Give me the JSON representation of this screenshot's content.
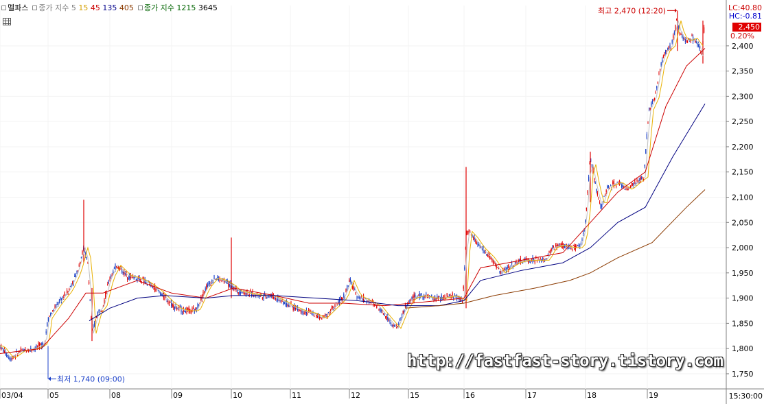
{
  "legend": {
    "title": "멜파스",
    "ma_label": "종가 지수",
    "ma_periods": [
      "5",
      "15",
      "45",
      "135",
      "405"
    ],
    "vol_label": "종가 지수",
    "vol_periods": [
      "1215",
      "3645"
    ]
  },
  "right_panel": {
    "lc": "LC:40.80",
    "hc": "HC:-0.81",
    "current_price": "2,450",
    "change_pct": "0.20%"
  },
  "annotations": {
    "high": "최고 2,470 (12:20)",
    "low": "최저 1,740 (09:00)"
  },
  "watermark": "http://fastfast-story.tistory.com",
  "end_time": "15:30:00",
  "colors": {
    "up": "#e00000",
    "down": "#1a3fc8",
    "ma5": "#c0c0c0",
    "ma15": "#e8b000",
    "ma45": "#cc0000",
    "ma135": "#000080",
    "ma405": "#8b3a00",
    "grid": "#f3f3f3",
    "axis": "#808080"
  },
  "chart_data": {
    "type": "candlestick",
    "title": "멜파스",
    "y_ticks": [
      1750,
      1800,
      1850,
      1900,
      1950,
      2000,
      2050,
      2100,
      2150,
      2200,
      2250,
      2300,
      2350,
      2400
    ],
    "y_tick_labels": [
      "1,750",
      "1,800",
      "1,850",
      "1,900",
      "1,950",
      "2,000",
      "2,050",
      "2,100",
      "2,150",
      "2,200",
      "2,250",
      "2,300",
      "2,350",
      "2,400"
    ],
    "ylim": [
      1720,
      2480
    ],
    "x_labels": [
      "03/04",
      "05",
      "08",
      "09",
      "10",
      "11",
      "12",
      "15",
      "16",
      "17",
      "18",
      "19"
    ],
    "x_label_positions": [
      0,
      70,
      160,
      250,
      337,
      423,
      509,
      595,
      676,
      766,
      853,
      943
    ],
    "x_total": 1058,
    "price_path": [
      [
        0,
        1805
      ],
      [
        15,
        1780
      ],
      [
        30,
        1795
      ],
      [
        50,
        1800
      ],
      [
        65,
        1810
      ],
      [
        70,
        1860
      ],
      [
        85,
        1890
      ],
      [
        100,
        1915
      ],
      [
        112,
        1950
      ],
      [
        122,
        2000
      ],
      [
        128,
        1970
      ],
      [
        134,
        1830
      ],
      [
        142,
        1870
      ],
      [
        150,
        1885
      ],
      [
        160,
        1940
      ],
      [
        170,
        1965
      ],
      [
        185,
        1945
      ],
      [
        200,
        1940
      ],
      [
        215,
        1930
      ],
      [
        230,
        1915
      ],
      [
        245,
        1895
      ],
      [
        258,
        1880
      ],
      [
        270,
        1875
      ],
      [
        285,
        1875
      ],
      [
        300,
        1920
      ],
      [
        312,
        1940
      ],
      [
        325,
        1935
      ],
      [
        337,
        1925
      ],
      [
        345,
        1915
      ],
      [
        360,
        1910
      ],
      [
        380,
        1905
      ],
      [
        395,
        1905
      ],
      [
        410,
        1895
      ],
      [
        423,
        1885
      ],
      [
        440,
        1875
      ],
      [
        455,
        1870
      ],
      [
        470,
        1860
      ],
      [
        485,
        1880
      ],
      [
        500,
        1900
      ],
      [
        510,
        1935
      ],
      [
        520,
        1905
      ],
      [
        535,
        1895
      ],
      [
        550,
        1885
      ],
      [
        565,
        1860
      ],
      [
        578,
        1840
      ],
      [
        590,
        1880
      ],
      [
        600,
        1900
      ],
      [
        615,
        1905
      ],
      [
        630,
        1900
      ],
      [
        645,
        1900
      ],
      [
        660,
        1905
      ],
      [
        674,
        1895
      ],
      [
        680,
        2035
      ],
      [
        690,
        2020
      ],
      [
        700,
        2000
      ],
      [
        715,
        1980
      ],
      [
        730,
        1950
      ],
      [
        740,
        1960
      ],
      [
        752,
        1970
      ],
      [
        765,
        1975
      ],
      [
        780,
        1975
      ],
      [
        795,
        1975
      ],
      [
        805,
        2000
      ],
      [
        818,
        2005
      ],
      [
        832,
        2000
      ],
      [
        845,
        2000
      ],
      [
        852,
        2040
      ],
      [
        860,
        2180
      ],
      [
        868,
        2120
      ],
      [
        876,
        2080
      ],
      [
        885,
        2120
      ],
      [
        900,
        2130
      ],
      [
        915,
        2115
      ],
      [
        928,
        2130
      ],
      [
        938,
        2140
      ],
      [
        945,
        2270
      ],
      [
        955,
        2300
      ],
      [
        962,
        2360
      ],
      [
        970,
        2390
      ],
      [
        978,
        2400
      ],
      [
        986,
        2450
      ],
      [
        992,
        2420
      ],
      [
        1000,
        2410
      ],
      [
        1010,
        2415
      ],
      [
        1018,
        2400
      ],
      [
        1022,
        2380
      ],
      [
        1027,
        2450
      ]
    ],
    "spikes": [
      {
        "x": 122,
        "high": 2095,
        "low": 1970
      },
      {
        "x": 134,
        "high": 1920,
        "low": 1815
      },
      {
        "x": 337,
        "high": 2020,
        "low": 1900
      },
      {
        "x": 679,
        "high": 2160,
        "low": 1880
      },
      {
        "x": 860,
        "high": 2190,
        "low": 2090
      },
      {
        "x": 987,
        "high": 2470,
        "low": 2390
      },
      {
        "x": 1024,
        "high": 2450,
        "low": 2365
      }
    ],
    "ma45": [
      [
        0,
        1790
      ],
      [
        60,
        1800
      ],
      [
        100,
        1860
      ],
      [
        125,
        1910
      ],
      [
        150,
        1910
      ],
      [
        200,
        1935
      ],
      [
        250,
        1910
      ],
      [
        300,
        1900
      ],
      [
        340,
        1920
      ],
      [
        400,
        1905
      ],
      [
        450,
        1890
      ],
      [
        500,
        1890
      ],
      [
        560,
        1885
      ],
      [
        600,
        1890
      ],
      [
        676,
        1900
      ],
      [
        700,
        1960
      ],
      [
        760,
        1975
      ],
      [
        820,
        1990
      ],
      [
        860,
        2050
      ],
      [
        900,
        2110
      ],
      [
        940,
        2150
      ],
      [
        970,
        2280
      ],
      [
        1000,
        2360
      ],
      [
        1027,
        2395
      ]
    ],
    "ma135": [
      [
        130,
        1855
      ],
      [
        160,
        1880
      ],
      [
        200,
        1900
      ],
      [
        240,
        1905
      ],
      [
        300,
        1900
      ],
      [
        340,
        1905
      ],
      [
        400,
        1905
      ],
      [
        460,
        1900
      ],
      [
        520,
        1895
      ],
      [
        580,
        1885
      ],
      [
        640,
        1885
      ],
      [
        676,
        1895
      ],
      [
        700,
        1935
      ],
      [
        760,
        1955
      ],
      [
        820,
        1970
      ],
      [
        860,
        2000
      ],
      [
        900,
        2050
      ],
      [
        940,
        2080
      ],
      [
        980,
        2180
      ],
      [
        1027,
        2285
      ]
    ],
    "ma405": [
      [
        590,
        1880
      ],
      [
        640,
        1885
      ],
      [
        676,
        1890
      ],
      [
        720,
        1905
      ],
      [
        780,
        1920
      ],
      [
        830,
        1935
      ],
      [
        860,
        1950
      ],
      [
        900,
        1980
      ],
      [
        950,
        2010
      ],
      [
        1000,
        2080
      ],
      [
        1027,
        2115
      ]
    ],
    "high_marker": {
      "x": 986,
      "y": 2470
    },
    "low_marker": {
      "x": 70,
      "y": 1740
    }
  }
}
